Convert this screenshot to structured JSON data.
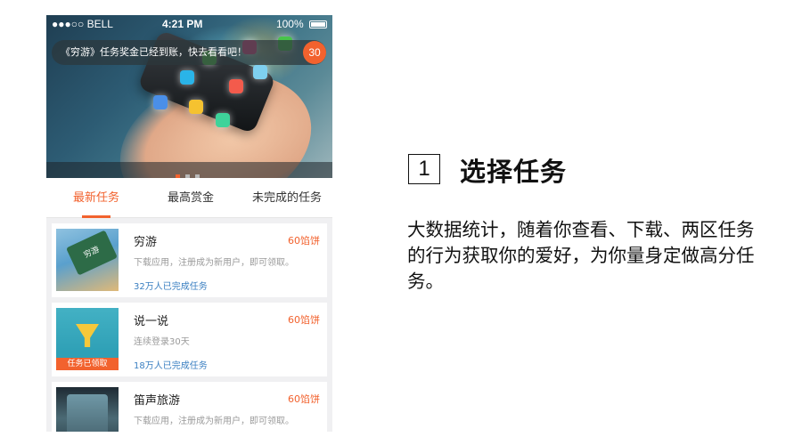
{
  "status_bar": {
    "carrier": "●●●○○ BELL",
    "time": "4:21 PM",
    "battery": "100%"
  },
  "notice": {
    "text": "《穷游》任务奖金已经到账，快去看看吧！",
    "count": "30"
  },
  "tabs": [
    {
      "label": "最新任务",
      "active": true
    },
    {
      "label": "最高赏金",
      "active": false
    },
    {
      "label": "未完成的任务",
      "active": false
    }
  ],
  "tasks": [
    {
      "title": "穷游",
      "reward": "60馅饼",
      "desc": "下载应用，注册成为新用户，即可领取。",
      "count": "32万人已完成任务",
      "thumb_text": "穷游"
    },
    {
      "title": "说一说",
      "reward": "60馅饼",
      "desc": "连续登录30天",
      "count": "18万人已完成任务",
      "thumb_text": "任务已领取"
    },
    {
      "title": "笛声旅游",
      "reward": "60馅饼",
      "desc": "下载应用，注册成为新用户，即可领取。",
      "count": ""
    }
  ],
  "step": {
    "number": "1",
    "title": "选择任务",
    "description": "大数据统计，随着你查看、下载、两区任务的行为获取你的爱好，为你量身定做高分任务。"
  },
  "colors": {
    "accent": "#f2622e",
    "link": "#3a7fc1"
  }
}
